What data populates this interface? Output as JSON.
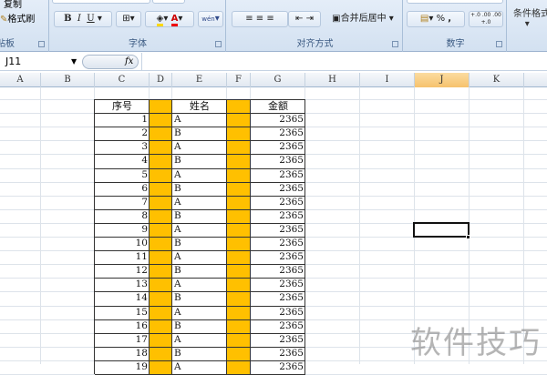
{
  "ribbon": {
    "clipboard": {
      "copy": "复制",
      "format_painter": "格式刷",
      "label": "剪贴板"
    },
    "font": {
      "bold": "B",
      "italic": "I",
      "underline": "U",
      "label": "字体",
      "phonetic": "wén"
    },
    "alignment": {
      "merge_center": "合并后居中",
      "label": "对齐方式"
    },
    "number": {
      "percent": "%",
      "comma": ",",
      "inc_decimal": "+.0 .00",
      "dec_decimal": ".00 +.0",
      "label": "数字"
    },
    "styles": {
      "conditional_format": "条件格式"
    }
  },
  "formula_bar": {
    "name_box": "J11",
    "fx": "fx",
    "formula": ""
  },
  "columns": [
    "A",
    "B",
    "C",
    "D",
    "E",
    "F",
    "G",
    "H",
    "I",
    "J",
    "K"
  ],
  "selected_column": "J",
  "selected_cell": "J11",
  "table": {
    "headers": {
      "seq": "序号",
      "name": "姓名",
      "amount": "金额"
    },
    "rows": [
      {
        "seq": "1",
        "name": "A",
        "amount": "2365"
      },
      {
        "seq": "2",
        "name": "B",
        "amount": "2365"
      },
      {
        "seq": "3",
        "name": "A",
        "amount": "2365"
      },
      {
        "seq": "4",
        "name": "B",
        "amount": "2365"
      },
      {
        "seq": "5",
        "name": "A",
        "amount": "2365"
      },
      {
        "seq": "6",
        "name": "B",
        "amount": "2365"
      },
      {
        "seq": "7",
        "name": "A",
        "amount": "2365"
      },
      {
        "seq": "8",
        "name": "B",
        "amount": "2365"
      },
      {
        "seq": "9",
        "name": "A",
        "amount": "2365"
      },
      {
        "seq": "10",
        "name": "B",
        "amount": "2365"
      },
      {
        "seq": "11",
        "name": "A",
        "amount": "2365"
      },
      {
        "seq": "12",
        "name": "B",
        "amount": "2365"
      },
      {
        "seq": "13",
        "name": "A",
        "amount": "2365"
      },
      {
        "seq": "14",
        "name": "B",
        "amount": "2365"
      },
      {
        "seq": "15",
        "name": "A",
        "amount": "2365"
      },
      {
        "seq": "16",
        "name": "B",
        "amount": "2365"
      },
      {
        "seq": "17",
        "name": "A",
        "amount": "2365"
      },
      {
        "seq": "18",
        "name": "B",
        "amount": "2365"
      },
      {
        "seq": "19",
        "name": "A",
        "amount": "2365"
      }
    ]
  },
  "watermark": "软件技巧",
  "colors": {
    "highlight": "#ffc000",
    "selected_header": "#f6c26c"
  }
}
